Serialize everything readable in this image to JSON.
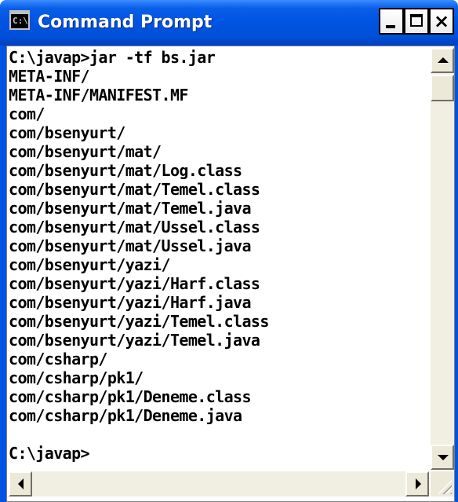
{
  "window": {
    "title": "Command Prompt",
    "icon": "console-app-icon",
    "icon_text": "C:\\",
    "buttons": {
      "minimize_icon": "minimize-icon",
      "maximize_icon": "maximize-icon",
      "close_glyph": "×"
    }
  },
  "console": {
    "lines": [
      "C:\\javap>jar -tf bs.jar",
      "META-INF/",
      "META-INF/MANIFEST.MF",
      "com/",
      "com/bsenyurt/",
      "com/bsenyurt/mat/",
      "com/bsenyurt/mat/Log.class",
      "com/bsenyurt/mat/Temel.class",
      "com/bsenyurt/mat/Temel.java",
      "com/bsenyurt/mat/Ussel.class",
      "com/bsenyurt/mat/Ussel.java",
      "com/bsenyurt/yazi/",
      "com/bsenyurt/yazi/Harf.class",
      "com/bsenyurt/yazi/Harf.java",
      "com/bsenyurt/yazi/Temel.class",
      "com/bsenyurt/yazi/Temel.java",
      "com/csharp/",
      "com/csharp/pk1/",
      "com/csharp/pk1/Deneme.class",
      "com/csharp/pk1/Deneme.java",
      "",
      "C:\\javap>"
    ]
  },
  "colors": {
    "titlebar": "#0054e3",
    "console_bg": "#ffffff",
    "console_text": "#000000"
  }
}
